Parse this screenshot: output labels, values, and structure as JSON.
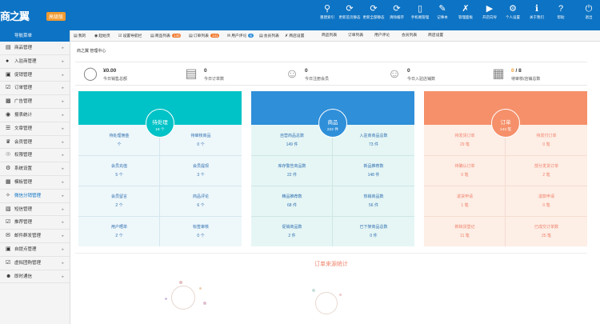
{
  "header": {
    "logo": "商之翼",
    "logo_badge": "高级版",
    "items": [
      {
        "icon": "search-icon",
        "label": "重建索引"
      },
      {
        "icon": "refresh-icon",
        "label": "更新首页静态"
      },
      {
        "icon": "refresh-icon",
        "label": "更新全部静态"
      },
      {
        "icon": "refresh-icon",
        "label": "清除缓存"
      },
      {
        "icon": "mobile-icon",
        "label": "手机端管理"
      },
      {
        "icon": "edit-icon",
        "label": "记事本"
      },
      {
        "icon": "wrench-icon",
        "label": "管理面板"
      },
      {
        "icon": "play-icon",
        "label": "开店向导"
      },
      {
        "icon": "gear-icon",
        "label": "个人设置"
      },
      {
        "icon": "info-icon",
        "label": "关于我们"
      },
      {
        "icon": "help-icon",
        "label": "帮助"
      },
      {
        "icon": "power-icon",
        "label": "退出"
      }
    ]
  },
  "sidebar": {
    "title": "导航菜单",
    "items": [
      {
        "icon": "goods-icon",
        "label": "商品管理"
      },
      {
        "icon": "store-icon",
        "label": "入驻商管理"
      },
      {
        "icon": "cart-icon",
        "label": "促销管理"
      },
      {
        "icon": "order-icon",
        "label": "订单管理"
      },
      {
        "icon": "ad-icon",
        "label": "广告管理"
      },
      {
        "icon": "report-icon",
        "label": "报表统计"
      },
      {
        "icon": "article-icon",
        "label": "文章管理"
      },
      {
        "icon": "vip-icon",
        "label": "会员管理"
      },
      {
        "icon": "rights-icon",
        "label": "权限管理"
      },
      {
        "icon": "settings-icon",
        "label": "系统设置"
      },
      {
        "icon": "template-icon",
        "label": "模板管理"
      },
      {
        "icon": "distribution-icon",
        "label": "微信分销管理"
      },
      {
        "icon": "db-icon",
        "label": "短信管理"
      },
      {
        "icon": "recommend-icon",
        "label": "推荐管理"
      },
      {
        "icon": "mail-icon",
        "label": "邮件群发管理"
      },
      {
        "icon": "pickup-icon",
        "label": "自提点管理"
      },
      {
        "icon": "virtual-icon",
        "label": "虚拟团购管理"
      },
      {
        "icon": "chat-icon",
        "label": "即时通信"
      }
    ],
    "active_index": 11
  },
  "tabs": [
    {
      "icon": "home-icon",
      "label": "我的",
      "badge": ""
    },
    {
      "icon": "start-icon",
      "label": "起始页",
      "badge": ""
    },
    {
      "icon": "setup-icon",
      "label": "设置导航栏",
      "badge": ""
    },
    {
      "icon": "list-icon",
      "label": "商品列表",
      "badge": "140"
    },
    {
      "icon": "list-icon",
      "label": "订单列表",
      "badge": "141"
    },
    {
      "icon": "comment-icon",
      "label": "用户评论",
      "badge": "6"
    },
    {
      "icon": "vip-icon",
      "label": "会员列表",
      "badge": ""
    },
    {
      "icon": "setting-icon",
      "label": "商店设置",
      "badge": ""
    },
    {
      "icon": "",
      "label": "商品列表",
      "badge": ""
    },
    {
      "icon": "",
      "label": "订单列表",
      "badge": ""
    },
    {
      "icon": "",
      "label": "用户评论",
      "badge": ""
    },
    {
      "icon": "",
      "label": "会员列表",
      "badge": ""
    },
    {
      "icon": "",
      "label": "商店设置",
      "badge": ""
    }
  ],
  "breadcrumb": "商之翼 管理中心",
  "stats": [
    {
      "icon": "yen-icon",
      "value": "¥0.00",
      "label": "今日销售总额"
    },
    {
      "icon": "clipboard-icon",
      "value": "0",
      "label": "今日订单数"
    },
    {
      "icon": "user-icon",
      "value": "0",
      "label": "今日注册会员"
    },
    {
      "icon": "users-icon",
      "value": "0",
      "label": "今日入驻店铺数"
    },
    {
      "icon": "shop-icon",
      "value_a": "0",
      "value_sep": "/",
      "value_b": "8",
      "label": "待审核/店铺总数"
    }
  ],
  "panels": [
    {
      "title": "待处理",
      "subtitle": "18 个",
      "cells": [
        {
          "label": "待处理佣金",
          "value": "个"
        },
        {
          "label": "待审核商品",
          "value": "0 个"
        },
        {
          "label": "会员充值",
          "value": "5 个"
        },
        {
          "label": "会员提现",
          "value": "3 个"
        },
        {
          "label": "会员留言",
          "value": "2 个"
        },
        {
          "label": "商品评论",
          "value": "6 个"
        },
        {
          "label": "用户晒单",
          "value": "2 个"
        },
        {
          "label": "标签审核",
          "value": "0 个"
        }
      ]
    },
    {
      "title": "商品",
      "subtitle": "222 件",
      "cells": [
        {
          "label": "自营商品总数",
          "value": "149 件"
        },
        {
          "label": "入驻商商品总数",
          "value": "73 件"
        },
        {
          "label": "库存警告商品数",
          "value": "22 件"
        },
        {
          "label": "新品推荐数",
          "value": "148 件"
        },
        {
          "label": "精品推荐数",
          "value": "68 件"
        },
        {
          "label": "热销商品数",
          "value": "56 件"
        },
        {
          "label": "促销商品数",
          "value": "2 件"
        },
        {
          "label": "已下架商品总数",
          "value": "0 件"
        }
      ]
    },
    {
      "title": "订单",
      "subtitle": "144 笔",
      "cells": [
        {
          "label": "待发货订单",
          "value": "29 笔"
        },
        {
          "label": "待发付订单",
          "value": "0 笔"
        },
        {
          "label": "待确认订单",
          "value": "0 笔"
        },
        {
          "label": "部分发货订单",
          "value": "2 笔"
        },
        {
          "label": "退货申请",
          "value": "1 笔"
        },
        {
          "label": "退款申请",
          "value": "0 笔"
        },
        {
          "label": "新缺货登记",
          "value": "11 笔"
        },
        {
          "label": "已成交订单数",
          "value": "25 笔"
        }
      ]
    }
  ],
  "bottom": {
    "title": "订单来源统计"
  },
  "colors": {
    "header_bg": "#0d73c4",
    "panel_1": "#00c3c7",
    "panel_2": "#2f8fd9",
    "panel_3": "#f5906a",
    "accent_orange": "#f29a2e"
  }
}
